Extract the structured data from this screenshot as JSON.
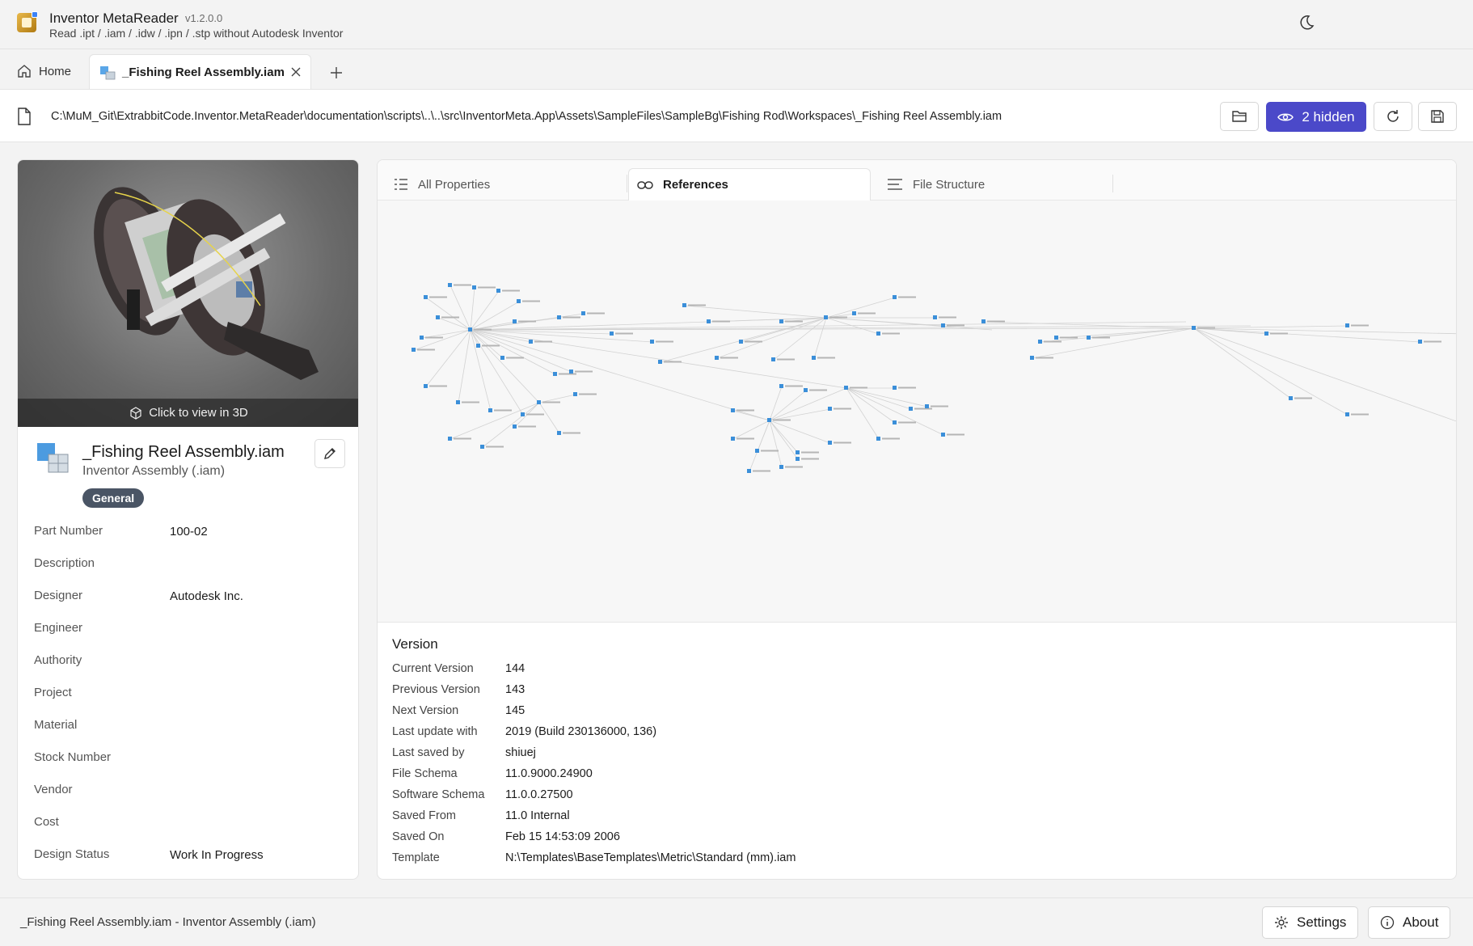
{
  "app": {
    "title": "Inventor MetaReader",
    "version": "v1.2.0.0",
    "subtitle": "Read .ipt / .iam / .idw / .ipn / .stp without Autodesk Inventor"
  },
  "tabs": {
    "home_label": "Home",
    "active_label": "_Fishing Reel Assembly.iam"
  },
  "pathbar": {
    "path": "C:\\MuM_Git\\ExtrabbitCode.Inventor.MetaReader\\documentation\\scripts\\..\\..\\src\\InventorMeta.App\\Assets\\SampleFiles\\SampleBg\\Fishing Rod\\Workspaces\\_Fishing Reel Assembly.iam",
    "hidden_label": "2 hidden"
  },
  "document": {
    "preview_label": "Click to view in 3D",
    "name": "_Fishing Reel Assembly.iam",
    "type": "Inventor Assembly (.iam)",
    "badge": "General",
    "properties": [
      {
        "label": "Part Number",
        "value": "100-02"
      },
      {
        "label": "Description",
        "value": ""
      },
      {
        "label": "Designer",
        "value": "Autodesk Inc."
      },
      {
        "label": "Engineer",
        "value": ""
      },
      {
        "label": "Authority",
        "value": ""
      },
      {
        "label": "Project",
        "value": ""
      },
      {
        "label": "Material",
        "value": ""
      },
      {
        "label": "Stock Number",
        "value": ""
      },
      {
        "label": "Vendor",
        "value": ""
      },
      {
        "label": "Cost",
        "value": ""
      },
      {
        "label": "Design Status",
        "value": "Work In Progress"
      }
    ]
  },
  "panel_tabs": {
    "all_properties": "All Properties",
    "references": "References",
    "file_structure": "File Structure"
  },
  "version": {
    "title": "Version",
    "rows": [
      {
        "label": "Current Version",
        "value": "144"
      },
      {
        "label": "Previous Version",
        "value": "143"
      },
      {
        "label": "Next Version",
        "value": "145"
      },
      {
        "label": "Last update with",
        "value": "2019 (Build 230136000, 136)"
      },
      {
        "label": "Last saved by",
        "value": "shiuej"
      },
      {
        "label": "File Schema",
        "value": "11.0.9000.24900"
      },
      {
        "label": "Software Schema",
        "value": "11.0.0.27500"
      },
      {
        "label": "Saved From",
        "value": "11.0 Internal"
      },
      {
        "label": "Saved On",
        "value": "Feb 15 14:53:09 2006"
      },
      {
        "label": "Template",
        "value": "N:\\Templates\\BaseTemplates\\Metric\\Standard (mm).iam"
      }
    ]
  },
  "statusbar": {
    "text": "_Fishing Reel Assembly.iam - Inventor Assembly (.iam)",
    "settings_label": "Settings",
    "about_label": "About"
  },
  "colors": {
    "accent": "#4b49c9",
    "badge": "#4a5565",
    "node": "#3b8fd9"
  },
  "icons": [
    "app-logo-icon",
    "moon-icon",
    "home-icon",
    "assembly-icon",
    "close-icon",
    "plus-icon",
    "file-icon",
    "folder-open-icon",
    "eye-icon",
    "refresh-icon",
    "save-icon",
    "cube-icon",
    "pencil-icon",
    "list-icon",
    "link-icon",
    "lines-icon",
    "gear-icon",
    "info-icon"
  ]
}
